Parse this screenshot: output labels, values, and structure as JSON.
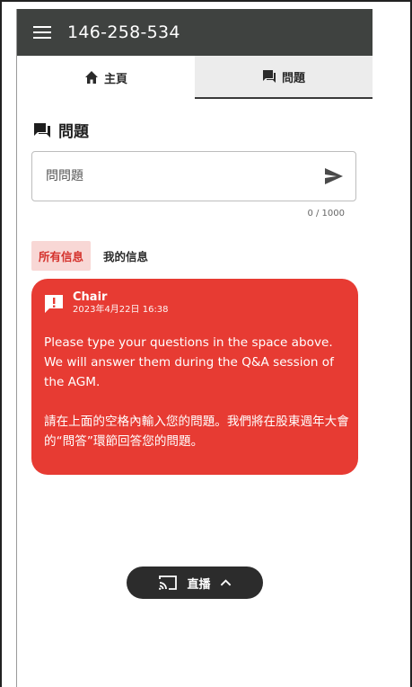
{
  "header": {
    "title": "146-258-534"
  },
  "tabs": [
    {
      "label": "主頁",
      "icon": "home-icon",
      "active": true
    },
    {
      "label": "問題",
      "icon": "chat-icon",
      "active": false
    }
  ],
  "section": {
    "title": "問題"
  },
  "question_input": {
    "placeholder": "問問題",
    "value": "",
    "counter": "0 / 1000"
  },
  "filters": [
    {
      "label": "所有信息",
      "active": true
    },
    {
      "label": "我的信息",
      "active": false
    }
  ],
  "message": {
    "author": "Chair",
    "timestamp": "2023年4月22日 16:38",
    "body_en": "Please type your questions in the space above.  We will answer them during the Q&A session of the AGM.",
    "body_zh": "請在上面的空格內輸入您的問題。我們將在股東週年大會的“問答”環節回答您的問題。"
  },
  "live_button": {
    "label": "直播"
  },
  "colors": {
    "appbar": "#3f4240",
    "accent_red": "#e73b33",
    "filter_active_bg": "#f8d7d5"
  }
}
